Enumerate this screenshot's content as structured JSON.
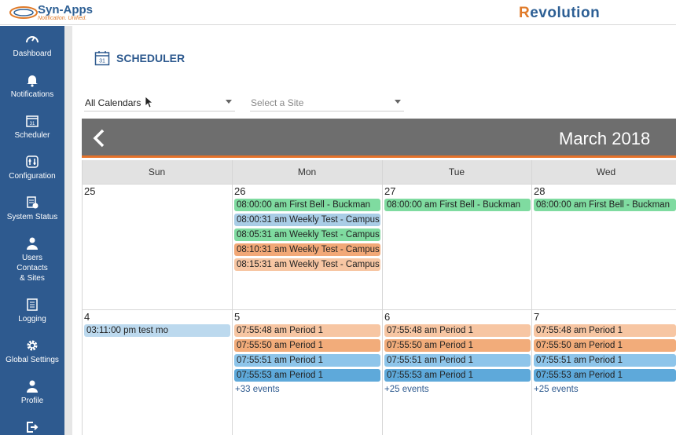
{
  "brand": {
    "left_name": "Syn-Apps",
    "left_tagline": "Notification. Unified.",
    "right_name_r": "R",
    "right_name_rest": "evolution"
  },
  "sidebar": {
    "items": [
      {
        "label": "Dashboard",
        "icon": "dashboard-icon"
      },
      {
        "label": "Notifications",
        "icon": "bell-icon"
      },
      {
        "label": "Scheduler",
        "icon": "calendar-icon"
      },
      {
        "label": "Configuration",
        "icon": "sliders-icon"
      },
      {
        "label": "System Status",
        "icon": "status-icon"
      },
      {
        "label": "Users\nContacts\n& Sites",
        "icon": "user-icon"
      },
      {
        "label": "Logging",
        "icon": "log-icon"
      },
      {
        "label": "Global Settings",
        "icon": "gear-icon"
      },
      {
        "label": "Profile",
        "icon": "user-icon"
      },
      {
        "label": "",
        "icon": "logout-icon"
      }
    ]
  },
  "page": {
    "title": "SCHEDULER",
    "calendar_icon_day": "31"
  },
  "filters": {
    "calendar_value": "All Calendars",
    "site_placeholder": "Select a Site"
  },
  "calendar": {
    "month_label": "March 2018",
    "weekdays": [
      "Sun",
      "Mon",
      "Tue",
      "Wed"
    ],
    "week1": {
      "days": [
        "25",
        "26",
        "27",
        "28"
      ],
      "mon_events": [
        "08:00:00 am First Bell - Buckman",
        "08:00:31 am Weekly Test - Campus",
        "08:05:31 am Weekly Test - Campus",
        "08:10:31 am Weekly Test - Campus",
        "08:15:31 am Weekly Test - Campus"
      ],
      "tue_events": [
        "08:00:00 am First Bell - Buckman"
      ],
      "wed_events": [
        "08:00:00 am First Bell - Buckman"
      ]
    },
    "week2": {
      "days": [
        "4",
        "5",
        "6",
        "7"
      ],
      "sun_events": [
        "03:11:00 pm test mo"
      ],
      "period_events": [
        "07:55:48 am Period 1",
        "07:55:50 am Period 1",
        "07:55:51 am Period 1",
        "07:55:53 am Period 1"
      ],
      "more": [
        "+33 events",
        "+25 events",
        "+25 events"
      ]
    },
    "colors": {
      "green": "#7fdba0",
      "lightblue": "#a9cde6",
      "orange": "#f2a877",
      "peach": "#f7c6a3",
      "sky": "#8ec5ea",
      "blue": "#5ea9da"
    }
  }
}
